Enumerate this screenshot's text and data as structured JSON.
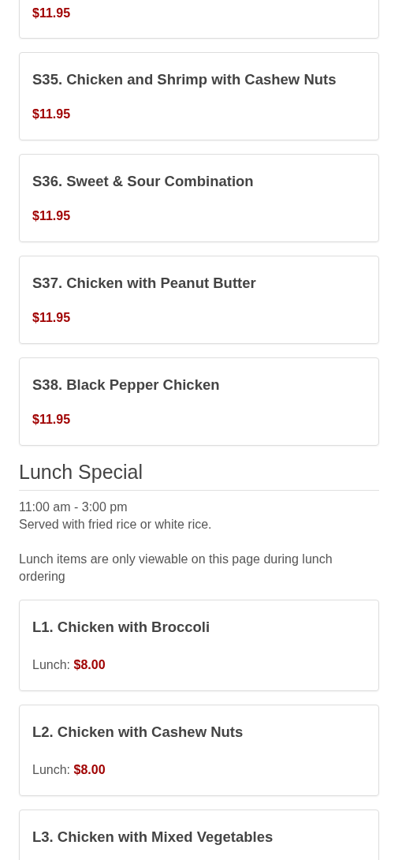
{
  "sections": [
    {
      "items": [
        {
          "price": "$11.95"
        },
        {
          "name": "S35. Chicken and Shrimp with Cashew Nuts",
          "price": "$11.95"
        },
        {
          "name": "S36. Sweet & Sour Combination",
          "price": "$11.95"
        },
        {
          "name": "S37. Chicken with Peanut Butter",
          "price": "$11.95"
        },
        {
          "name": "S38. Black Pepper Chicken",
          "price": "$11.95"
        }
      ]
    },
    {
      "title": "Lunch Special",
      "hours": "11:00 am - 3:00 pm",
      "served": "Served with fried rice or white rice.",
      "note": "Lunch items are only viewable on this page during lunch ordering",
      "items": [
        {
          "name": "L1. Chicken with Broccoli",
          "price_label": "Lunch:",
          "price": "$8.00"
        },
        {
          "name": "L2. Chicken with Cashew Nuts",
          "price_label": "Lunch:",
          "price": "$8.00"
        },
        {
          "name": "L3. Chicken with Mixed Vegetables"
        }
      ]
    }
  ]
}
